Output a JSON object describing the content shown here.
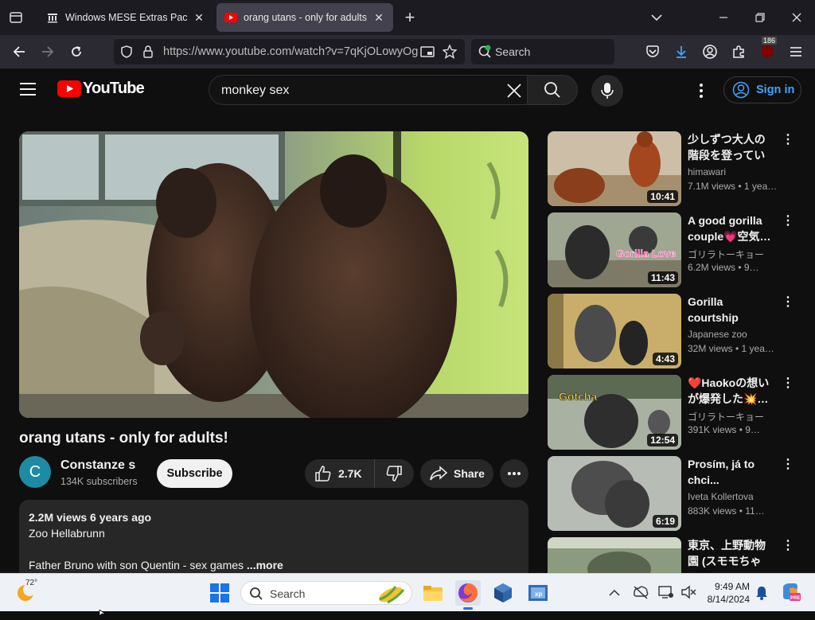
{
  "browser": {
    "tabs": [
      {
        "title": "Windows MESE Extras Pack : Fre",
        "active": false
      },
      {
        "title": "orang utans - only for adults! -",
        "active": true
      }
    ],
    "url": "https://www.youtube.com/watch?v=7qKjOLowyOg",
    "search_placeholder": "Search",
    "notif_badge": "186"
  },
  "youtube": {
    "logo_text": "YouTube",
    "search_value": "monkey sex",
    "sign_in": "Sign in"
  },
  "video": {
    "title": "orang utans - only for adults!",
    "channel": "Constanze s",
    "channel_initial": "C",
    "subscribers": "134K subscribers",
    "subscribe_label": "Subscribe",
    "likes": "2.7K",
    "share_label": "Share",
    "description": {
      "views_date": "2.2M views  6 years ago",
      "line1": "Zoo Hellabrunn",
      "line2": "Father Bruno with son Quentin  - sex games ",
      "more": "...more"
    }
  },
  "recommendations": [
    {
      "title": "少しずつ大人の階段を登っている…",
      "channel": "himawari",
      "meta": "7.1M views  • 1 yea…",
      "duration": "10:41"
    },
    {
      "title": "A good gorilla couple💗空気…",
      "channel": "ゴリラトーキョー",
      "meta": "6.2M views  • 9…",
      "duration": "11:43"
    },
    {
      "title": "Gorilla courtship Shabani and Ai…",
      "channel": "Japanese zoo",
      "meta": "32M views  • 1 yea…",
      "duration": "4:43"
    },
    {
      "title": "❤️Haokoの想いが爆発した💥…",
      "channel": "ゴリラトーキョー",
      "meta": "391K views  • 9…",
      "duration": "12:54"
    },
    {
      "title": "Prosím, já to chci...",
      "channel": "Iveta Kollertova",
      "meta": "883K views  • 11…",
      "duration": "6:19"
    },
    {
      "title": "東京、上野動物園 (スモモちゃん…",
      "channel": "",
      "meta": "",
      "duration": ""
    }
  ],
  "taskbar": {
    "weather_temp": "72°",
    "search_label": "Search",
    "time": "9:49 AM",
    "date": "8/14/2024"
  }
}
